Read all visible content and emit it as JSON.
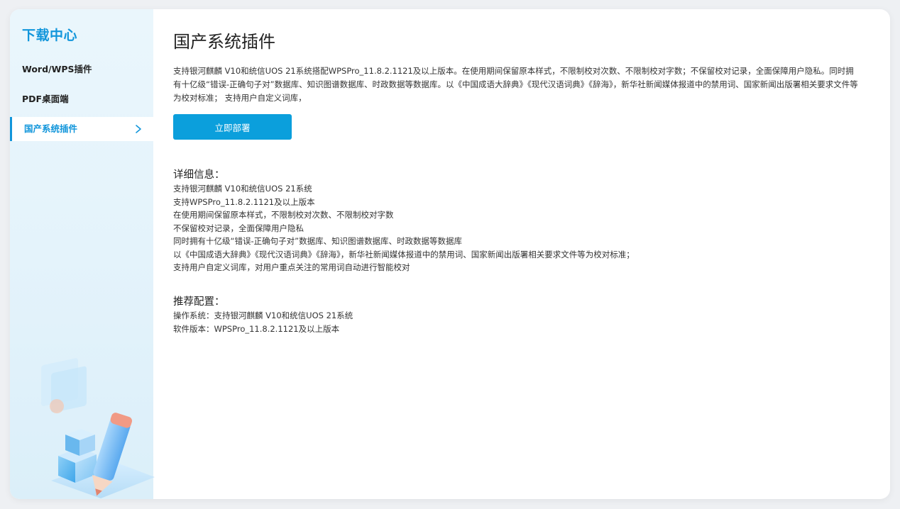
{
  "sidebar": {
    "brand": "下载中心",
    "items": [
      {
        "label": "Word/WPS插件"
      },
      {
        "label": "PDF桌面端"
      },
      {
        "label": "国产系统插件"
      }
    ]
  },
  "main": {
    "title": "国产系统插件",
    "intro": "支持银河麒麟 V10和统信UOS 21系统搭配WPSPro_11.8.2.1121及以上版本。在使用期间保留原本样式，不限制校对次数、不限制校对字数；不保留校对记录，全面保障用户隐私。同时拥有十亿级“错误-正确句子对”数据库、知识图谱数据库、时政数据等数据库。以《中国成语大辞典》《现代汉语词典》《辞海》，新华社新闻媒体报道中的禁用词、国家新闻出版署相关要求文件等为校对标准；  支持用户自定义词库，",
    "deploy_label": "立即部署",
    "details": {
      "title": "详细信息：",
      "lines": [
        "支持银河麒麟 V10和统信UOS 21系统",
        "支持WPSPro_11.8.2.1121及以上版本",
        "在使用期间保留原本样式，不限制校对次数、不限制校对字数",
        "不保留校对记录，全面保障用户隐私",
        "同时拥有十亿级“错误-正确句子对”数据库、知识图谱数据库、时政数据等数据库",
        "以《中国成语大辞典》《现代汉语词典》《辞海》，新华社新闻媒体报道中的禁用词、国家新闻出版署相关要求文件等为校对标准；",
        "支持用户自定义词库，对用户重点关注的常用词自动进行智能校对"
      ]
    },
    "config": {
      "title": "推荐配置：",
      "lines": [
        "操作系统：支持银河麒麟 V10和统信UOS 21系统",
        "软件版本：WPSPro_11.8.2.1121及以上版本"
      ]
    }
  },
  "colors": {
    "accent": "#1296db",
    "button": "#0b9fdc",
    "sidebar_bg": "#e6f4fb"
  },
  "icons": {
    "active_item": "chevron-right-icon",
    "illustration": "pencil-cubes-illustration"
  }
}
